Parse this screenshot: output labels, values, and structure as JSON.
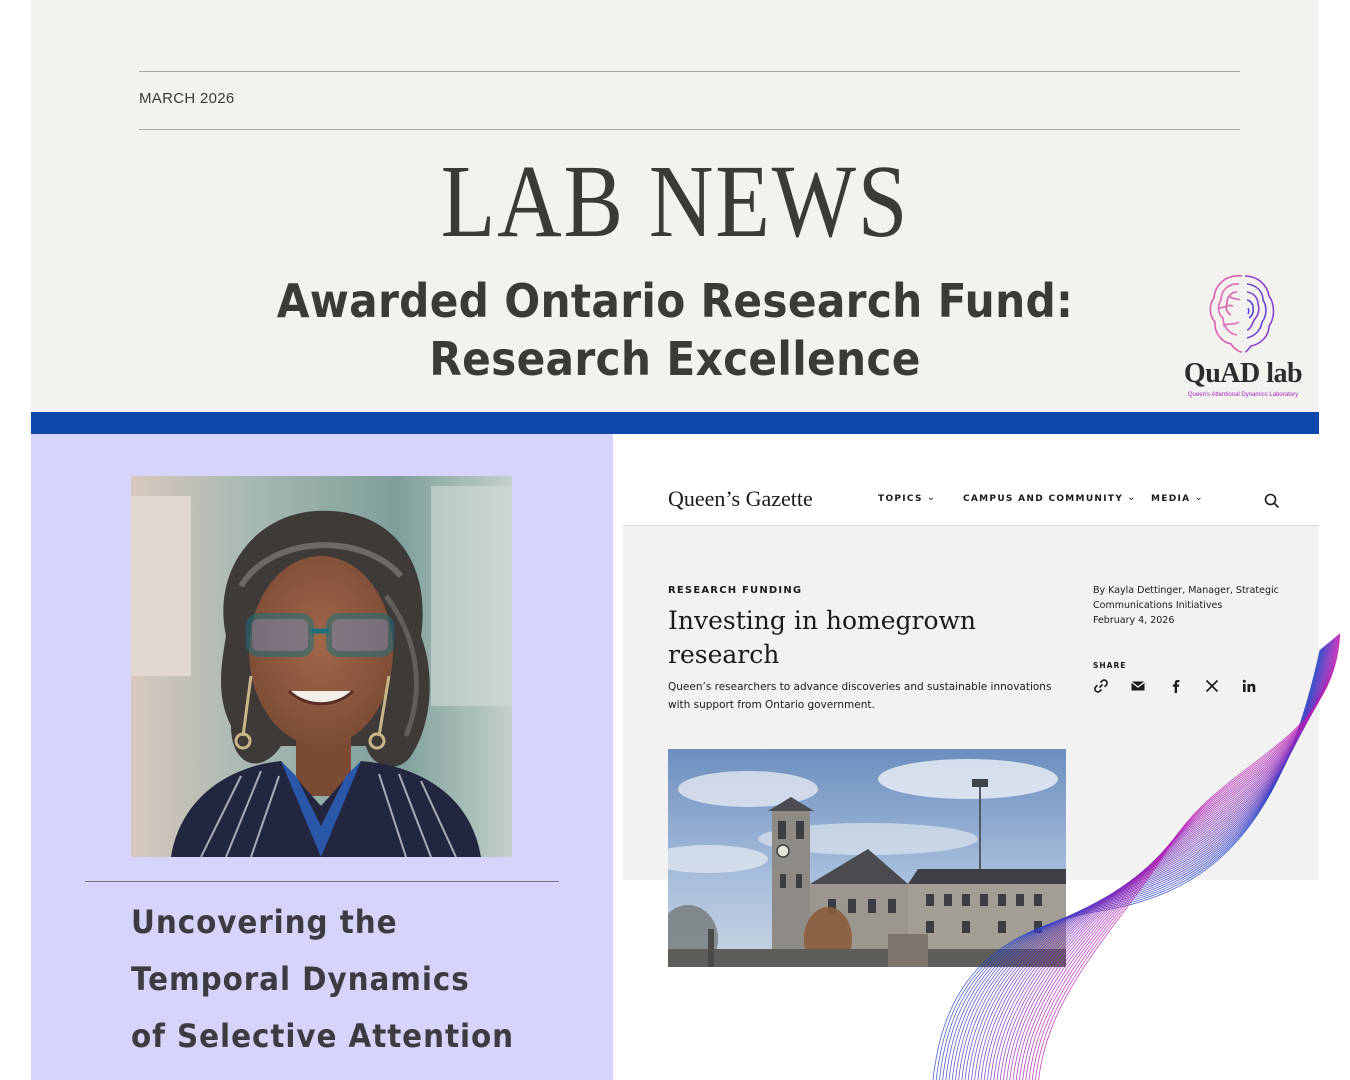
{
  "header": {
    "issue_date": "MARCH 2026",
    "masthead": "LAB NEWS",
    "headline_line1": "Awarded Ontario Research Fund:",
    "headline_line2": "Research Excellence"
  },
  "logo": {
    "name": "QuAD lab",
    "subtitle": "Queen's Attentional Dynamics Laboratory",
    "icon": "brain-fingerprint-icon"
  },
  "feature": {
    "title_line1": "Uncovering the",
    "title_line2": "Temporal Dynamics",
    "title_line3": "of Selective Attention"
  },
  "gazette": {
    "brand": "Queen’s Gazette",
    "nav": [
      {
        "label": "TOPICS"
      },
      {
        "label": "CAMPUS AND COMMUNITY"
      },
      {
        "label": "MEDIA"
      }
    ],
    "kicker": "RESEARCH FUNDING",
    "title": "Investing in homegrown research",
    "dek": "Queen’s researchers to advance discoveries and sustainable innovations with support from Ontario government.",
    "byline_line1": "By Kayla Dettinger, Manager, Strategic",
    "byline_line2": "Communications Initiatives",
    "date": "February 4, 2026",
    "share_label": "SHARE",
    "share_icons": [
      "link-icon",
      "mail-icon",
      "facebook-icon",
      "x-icon",
      "linkedin-icon"
    ]
  },
  "colors": {
    "header_bg": "#f3f2ee",
    "accent_blue": "#0d47a9",
    "panel_lavender": "#d7d4fc",
    "text_dark": "#3b3a36",
    "logo_magenta": "#a523c9"
  }
}
